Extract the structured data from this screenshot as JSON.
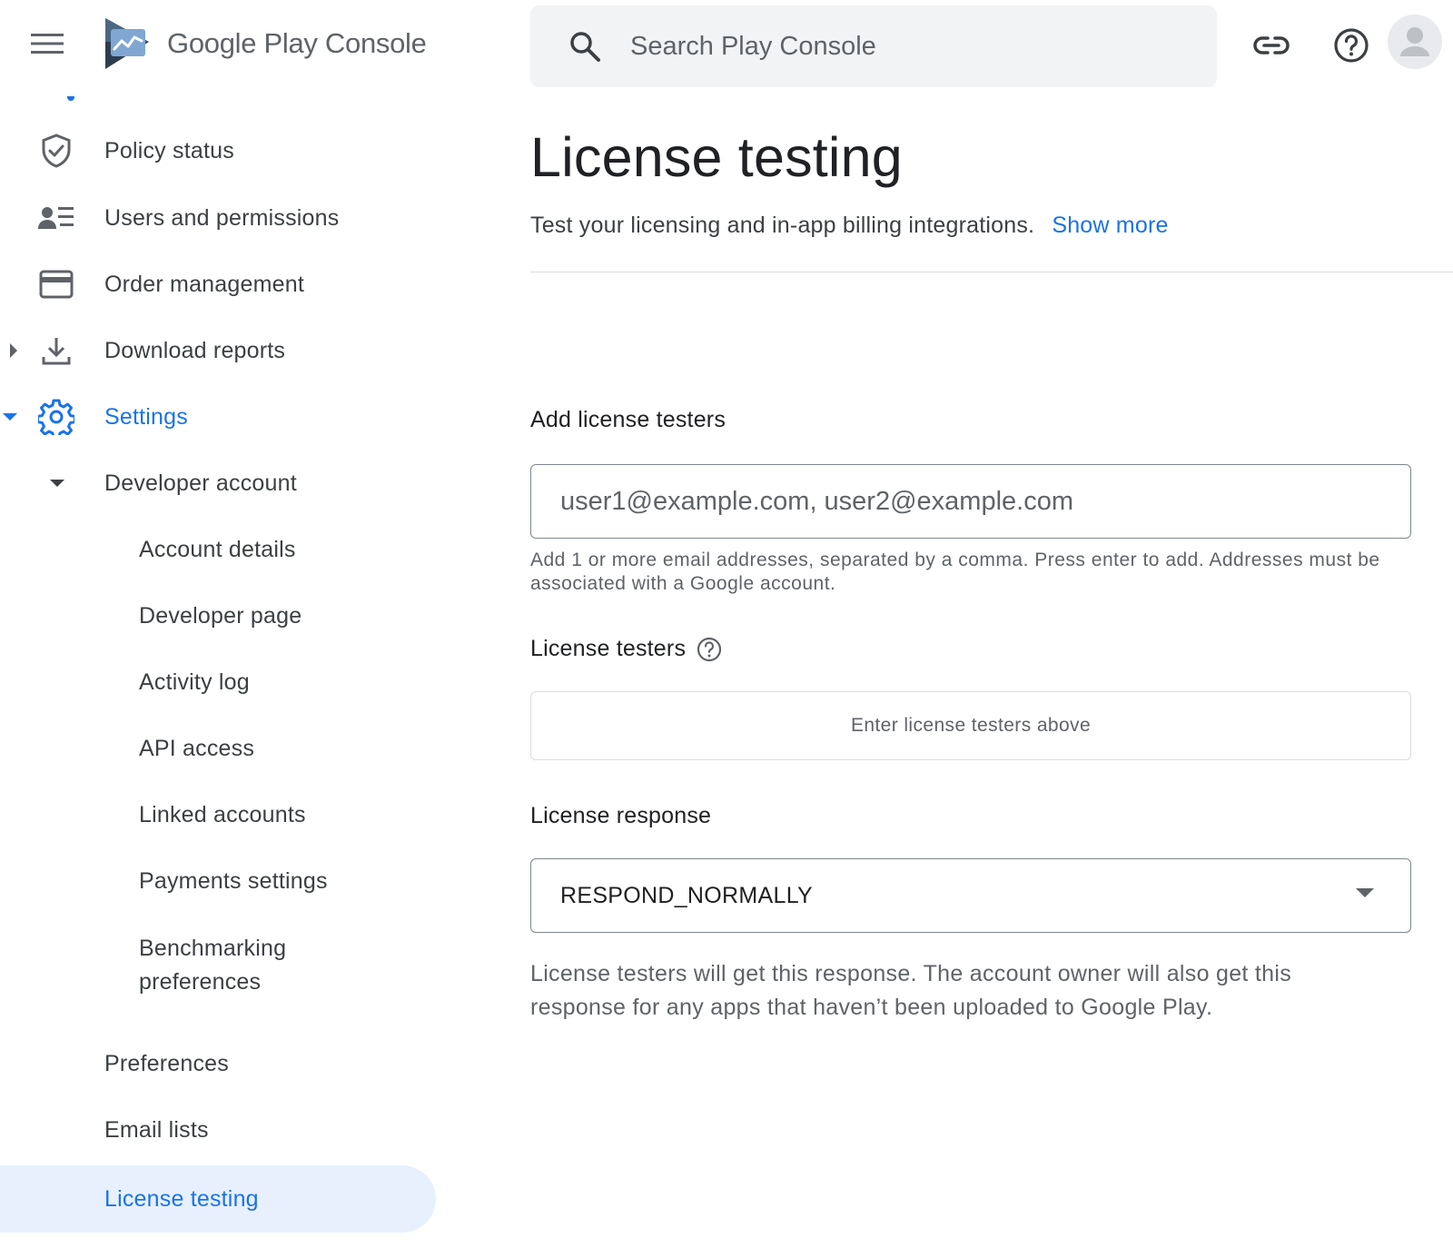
{
  "header": {
    "brand_google_play": "Google Play",
    "brand_console": "Console",
    "search_placeholder": "Search Play Console",
    "icons": [
      "menu-icon",
      "play-console-logo",
      "search-icon",
      "link-icon",
      "help-icon",
      "avatar"
    ]
  },
  "sidebar": {
    "items": [
      {
        "label": "Policy status",
        "icon": "shield-check-icon"
      },
      {
        "label": "Users and permissions",
        "icon": "users-list-icon"
      },
      {
        "label": "Order management",
        "icon": "credit-card-icon"
      },
      {
        "label": "Download reports",
        "icon": "download-icon"
      },
      {
        "label": "Settings",
        "icon": "gear-icon"
      },
      {
        "label": "Developer account"
      },
      {
        "label": "Account details"
      },
      {
        "label": "Developer page"
      },
      {
        "label": "Activity log"
      },
      {
        "label": "API access"
      },
      {
        "label": "Linked accounts"
      },
      {
        "label": "Payments settings"
      },
      {
        "label": "Benchmarking preferences"
      },
      {
        "label": "Preferences"
      },
      {
        "label": "Email lists"
      },
      {
        "label": "License testing"
      }
    ],
    "active": "License testing"
  },
  "main": {
    "title": "License testing",
    "subtitle": "Test your licensing and in-app billing integrations.",
    "show_more": "Show more",
    "add_testers_label": "Add license testers",
    "add_testers_placeholder": "user1@example.com, user2@example.com",
    "add_testers_helper": "Add 1 or more email addresses, separated by a comma. Press enter to add. Addresses must be associated with a Google account.",
    "testers_label": "License testers",
    "testers_empty": "Enter license testers above",
    "response_label": "License response",
    "response_value": "RESPOND_NORMALLY",
    "response_note": "License testers will get this response. The account owner will also get this response for any apps that haven’t been uploaded to Google Play."
  },
  "colors": {
    "accent": "#1a73e8",
    "active_bg": "#e8f0fe",
    "text": "#202124",
    "secondary": "#5f6368"
  }
}
